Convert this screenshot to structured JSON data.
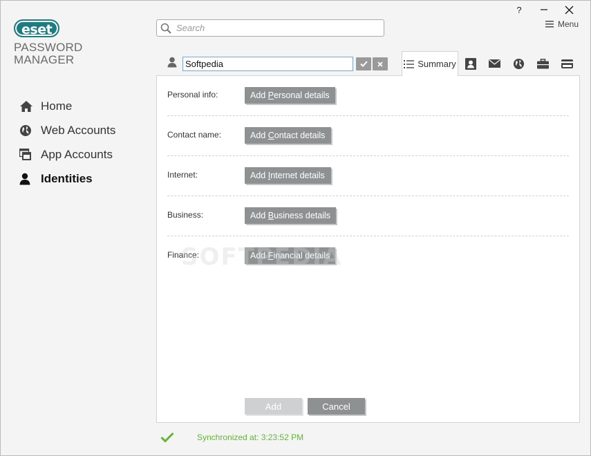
{
  "window": {
    "help_label": "?",
    "menu_label": "Menu"
  },
  "logo": {
    "brand": "eset",
    "product_line1": "PASSWORD",
    "product_line2": "MANAGER"
  },
  "search": {
    "placeholder": "Search",
    "value": ""
  },
  "sidebar": {
    "items": [
      {
        "label": "Home",
        "icon": "home-icon",
        "active": false
      },
      {
        "label": "Web Accounts",
        "icon": "globe-icon",
        "active": false
      },
      {
        "label": "App Accounts",
        "icon": "app-window-icon",
        "active": false
      },
      {
        "label": "Identities",
        "icon": "person-icon",
        "active": true
      }
    ]
  },
  "identity": {
    "name_value": "Softpedia"
  },
  "tabs": {
    "summary_label": "Summary",
    "icons": [
      "contact-card-icon",
      "envelope-icon",
      "globe-icon",
      "briefcase-icon",
      "credit-card-icon"
    ]
  },
  "details": [
    {
      "label": "Personal info:",
      "button_pre": "Add ",
      "button_key": "P",
      "button_post": "ersonal details"
    },
    {
      "label": "Contact name:",
      "button_pre": "Add ",
      "button_key": "C",
      "button_post": "ontact details"
    },
    {
      "label": "Internet:",
      "button_pre": "Add ",
      "button_key": "I",
      "button_post": "nternet details"
    },
    {
      "label": "Business:",
      "button_pre": "Add ",
      "button_key": "B",
      "button_post": "usiness details"
    },
    {
      "label": "Finance:",
      "button_pre": "Add ",
      "button_key": "F",
      "button_post": "inancial details"
    }
  ],
  "watermark": "SOFTPEDIA",
  "footer": {
    "add_label": "Add",
    "cancel_label": "Cancel"
  },
  "status": {
    "text": "Synchronized at: 3:23:52 PM"
  },
  "colors": {
    "brand": "#1e7b7f",
    "button_gray": "#8e9192",
    "status_green": "#64b33a"
  }
}
